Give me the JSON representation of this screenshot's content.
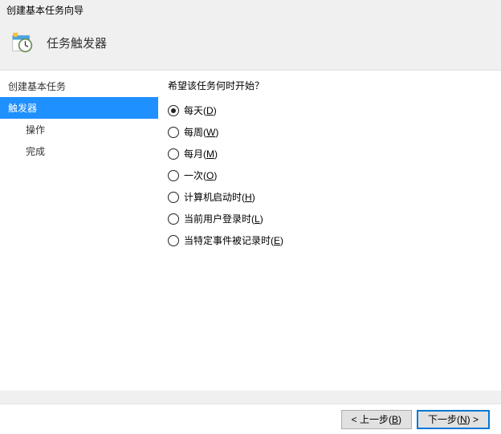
{
  "window": {
    "title": "创建基本任务向导"
  },
  "header": {
    "title": "任务触发器"
  },
  "sidebar": {
    "items": [
      {
        "label": "创建基本任务",
        "selected": false
      },
      {
        "label": "触发器",
        "selected": true
      },
      {
        "label": "操作",
        "selected": false
      },
      {
        "label": "完成",
        "selected": false
      }
    ]
  },
  "content": {
    "prompt": "希望该任务何时开始？",
    "options": [
      {
        "label": "每天",
        "accel": "D",
        "checked": true
      },
      {
        "label": "每周",
        "accel": "W",
        "checked": false
      },
      {
        "label": "每月",
        "accel": "M",
        "checked": false
      },
      {
        "label": "一次",
        "accel": "O",
        "checked": false
      },
      {
        "label": "计算机启动时",
        "accel": "H",
        "checked": false
      },
      {
        "label": "当前用户登录时",
        "accel": "L",
        "checked": false
      },
      {
        "label": "当特定事件被记录时",
        "accel": "E",
        "checked": false
      }
    ]
  },
  "footer": {
    "back": {
      "pre": "< 上一步(",
      "accel": "B",
      "post": ")"
    },
    "next": {
      "pre": "下一步(",
      "accel": "N",
      "post": ") >"
    }
  }
}
